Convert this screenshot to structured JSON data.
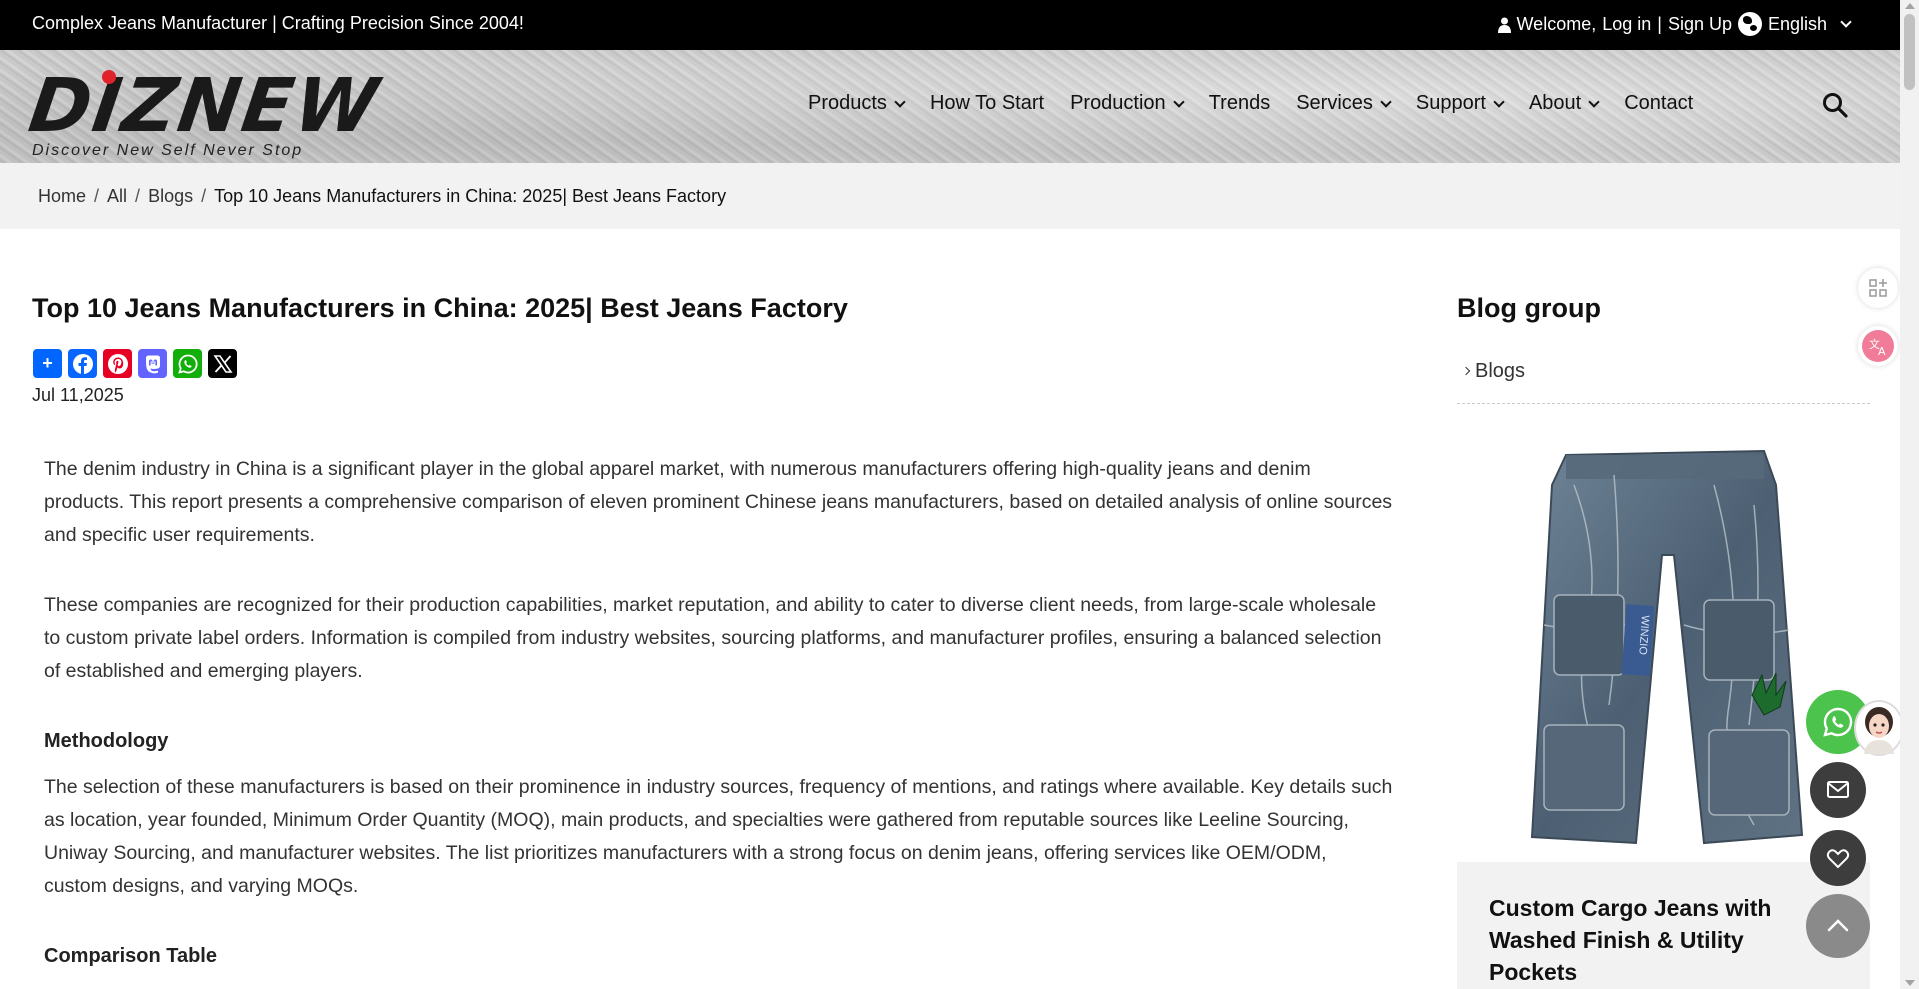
{
  "topbar": {
    "tagline": "Complex Jeans Manufacturer | Crafting Precision Since 2004!",
    "welcome": "Welcome,",
    "login": "Log in",
    "divider": "|",
    "signup": "Sign Up",
    "language": "English"
  },
  "header": {
    "logo_text": "DIZNEW",
    "logo_slogan": "Discover New Self Never Stop",
    "nav": [
      {
        "label": "Products",
        "dropdown": true
      },
      {
        "label": "How To Start",
        "dropdown": false
      },
      {
        "label": "Production",
        "dropdown": true
      },
      {
        "label": "Trends",
        "dropdown": false
      },
      {
        "label": "Services",
        "dropdown": true
      },
      {
        "label": "Support",
        "dropdown": true
      },
      {
        "label": "About",
        "dropdown": true
      },
      {
        "label": "Contact",
        "dropdown": false
      }
    ]
  },
  "breadcrumb": {
    "items": [
      "Home",
      "All",
      "Blogs"
    ],
    "separator": "/",
    "current": "Top 10 Jeans Manufacturers in China: 2025| Best Jeans Factory"
  },
  "article": {
    "title": "Top 10 Jeans Manufacturers in China: 2025| Best Jeans Factory",
    "date": "Jul 11,2025",
    "share_buttons": [
      {
        "name": "share-plus-icon",
        "glyph": "+",
        "color": "#0166ff"
      },
      {
        "name": "facebook-icon",
        "glyph": "f",
        "color": "#0866ff"
      },
      {
        "name": "pinterest-icon",
        "glyph": "P",
        "color": "#e60023"
      },
      {
        "name": "mastodon-icon",
        "glyph": "m",
        "color": "#6364ff"
      },
      {
        "name": "whatsapp-icon",
        "glyph": "✆",
        "color": "#12af0a"
      },
      {
        "name": "x-icon",
        "glyph": "X",
        "color": "#000000"
      }
    ],
    "paragraph_1": "The denim industry in China is a significant player in the global apparel market, with numerous manufacturers offering high-quality jeans and denim products. This report presents a comprehensive comparison of eleven prominent Chinese jeans manufacturers, based on detailed analysis of online sources and specific user requirements.",
    "paragraph_2": "These companies are recognized for their production capabilities, market reputation, and ability to cater to diverse client needs, from large-scale wholesale to custom private label orders. Information is compiled from industry websites, sourcing platforms, and manufacturer profiles, ensuring a balanced selection of established and emerging players.",
    "heading_methodology": "Methodology",
    "paragraph_3": "The selection of these manufacturers is based on their prominence in industry sources, frequency of mentions, and ratings where available. Key details such as location, year founded, Minimum Order Quantity (MOQ), main products, and specialties were gathered from reputable sources like Leeline Sourcing, Uniway Sourcing, and manufacturer websites. The list prioritizes manufacturers with a strong focus on denim jeans, offering services like OEM/ODM, custom designs, and varying MOQs.",
    "heading_comparison": "Comparison Table"
  },
  "sidebar": {
    "title": "Blog group",
    "link": "Blogs",
    "product_title": "Custom Cargo Jeans with Washed Finish & Utility Pockets",
    "patch_text": "WINZIO"
  },
  "colors": {
    "whatsapp": "#4cc34c",
    "dark_button": "#3d3d3d",
    "topbar": "#000000",
    "breadcrumb_bg": "#f2f2f2",
    "logo_dot": "#e0232a"
  }
}
